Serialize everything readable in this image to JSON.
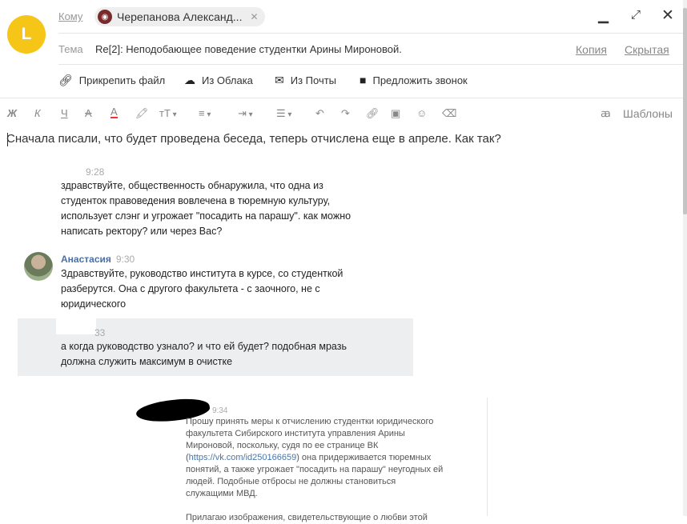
{
  "header": {
    "sender_initial": "L",
    "to_label": "Кому",
    "recipient_name": "Черепанова Александ...",
    "subject_label": "Тема",
    "subject_value": "Re[2]: Неподобающее поведение студентки Арины Мироновой.",
    "cc_label": "Копия",
    "bcc_label": "Скрытая"
  },
  "attach": {
    "file": "Прикрепить файл",
    "cloud": "Из Облака",
    "mail": "Из Почты",
    "call": "Предложить звонок"
  },
  "toolbar": {
    "bold": "Ж",
    "italic": "К",
    "underline": "Ч",
    "strike": "А",
    "color": "А",
    "templates": "Шаблоны"
  },
  "body": {
    "text": "Сначала писали, что будет проведена беседа, теперь отчислена еще в апреле. Как так?"
  },
  "messages": [
    {
      "time": "9:28",
      "lines": [
        "здравствуйте, общественность обнаружила, что одна из",
        "студенток правоведения вовлечена в тюремную культуру,",
        "использует слэнг и угрожает \"посадить на парашу\". как можно",
        "написать ректору? или через Вас?"
      ]
    },
    {
      "name": "Анастасия",
      "time": "9:30",
      "lines": [
        "Здравствуйте, руководство института в курсе, со студенткой",
        "разберутся. Она с другого факультета - с заочного, не с",
        "юридического"
      ]
    },
    {
      "time": "33",
      "lines": [
        "а когда руководство узнало? и что ей будет? подобная мразь",
        "должна служить максимум в очистке"
      ]
    }
  ],
  "screenshot": {
    "time": "9:34",
    "lines": [
      "Прошу принять меры к отчислению студентки юридического",
      "факультета Сибирского института управления Арины",
      "Мироновой, поскольку, судя по ее странице ВК",
      "(https://vk.com/id250166659) она придерживается тюремных",
      "понятий, а также угрожает \"посадить на парашу\" неугодных ей",
      "людей. Подобные отбросы не должны становиться",
      "служащими МВД.",
      "",
      "Прилагаю изображения, свидетельствующие о любви этой"
    ]
  }
}
